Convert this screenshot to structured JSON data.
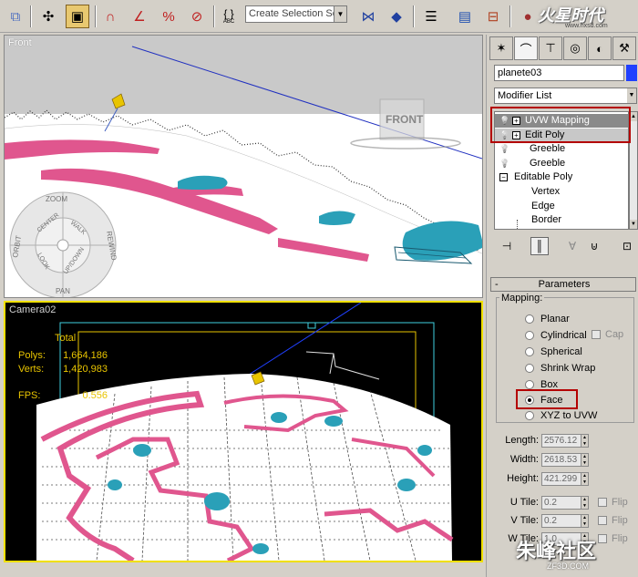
{
  "toolbar": {
    "selection_set_placeholder": "Create Selection Set",
    "selection_dropdown_arrow": "▼",
    "abc_label": "ABC"
  },
  "logo": {
    "text": "火星时代",
    "url": "www.hxsd.com"
  },
  "viewports": {
    "front": {
      "label": "Front",
      "gizmo_label": "FRONT"
    },
    "camera": {
      "label": "Camera02",
      "stats_header": "Total",
      "polys_label": "Polys:",
      "polys_value": "1,664,186",
      "verts_label": "Verts:",
      "verts_value": "1,420,983",
      "fps_label": "FPS:",
      "fps_value": "0.556"
    },
    "steering_wheel": {
      "zoom": "ZOOM",
      "orbit": "ORBIT",
      "center": "CENTER",
      "walk": "WALK",
      "rewind": "REWIND",
      "look": "LOOK",
      "up_down": "UP/DOWN",
      "pan": "PAN"
    }
  },
  "command_panel": {
    "object_name": "planete03",
    "object_color": "#2040ff",
    "modifier_list_label": "Modifier List",
    "stack": [
      {
        "label": "UVW Mapping",
        "kind": "modifier",
        "selected": true
      },
      {
        "label": "Edit Poly",
        "kind": "modifier",
        "selected": false
      },
      {
        "label": "Greeble",
        "kind": "plain"
      },
      {
        "label": "Greeble",
        "kind": "plain"
      },
      {
        "label": "Editable Poly",
        "kind": "base"
      },
      {
        "label": "Vertex",
        "kind": "sub"
      },
      {
        "label": "Edge",
        "kind": "sub"
      },
      {
        "label": "Border",
        "kind": "sub"
      }
    ],
    "parameters": {
      "rollout_minus": "-",
      "rollout_title": "Parameters",
      "mapping_label": "Mapping:",
      "options": [
        {
          "label": "Planar",
          "checked": false
        },
        {
          "label": "Cylindrical",
          "checked": false
        },
        {
          "label": "Spherical",
          "checked": false
        },
        {
          "label": "Shrink Wrap",
          "checked": false
        },
        {
          "label": "Box",
          "checked": false
        },
        {
          "label": "Face",
          "checked": true
        },
        {
          "label": "XYZ to UVW",
          "checked": false
        }
      ],
      "cap_label": "Cap",
      "length_label": "Length:",
      "length_value": "2576.12",
      "width_label": "Width:",
      "width_value": "2618.53",
      "height_label": "Height:",
      "height_value": "421.299",
      "utile_label": "U Tile:",
      "utile_value": "0.2",
      "vtile_label": "V Tile:",
      "vtile_value": "0.2",
      "wtile_label": "W Tile:",
      "wtile_value": "1.0",
      "flip_label": "Flip"
    }
  },
  "watermark": {
    "text": "朱峰社区",
    "url": "ZF3D.COM"
  },
  "colors": {
    "panel_bg": "#d4d0c8",
    "highlight_red": "#b40000",
    "mesh_pink": "#e0568e",
    "mesh_cyan": "#2aa0b8",
    "stats_yellow": "#e8c400",
    "active_viewport_border": "#f0e000"
  }
}
